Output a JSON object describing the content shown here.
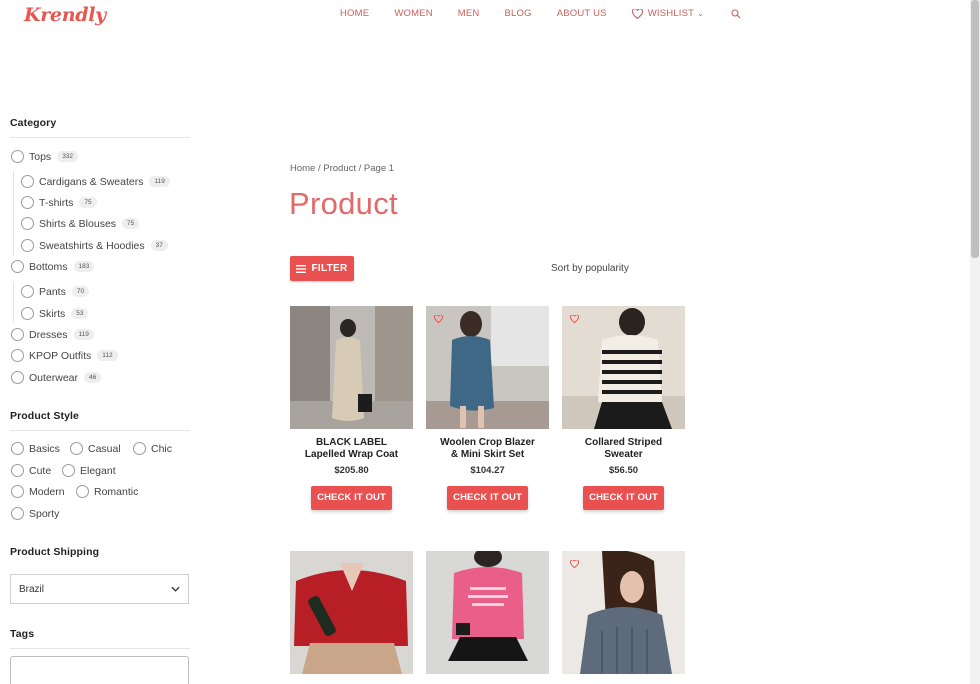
{
  "brand": {
    "logo": "Krendly",
    "accent": "#e8514f"
  },
  "nav": {
    "items": [
      "HOME",
      "WOMEN",
      "MEN",
      "BLOG",
      "ABOUT US"
    ],
    "wishlist": "WISHLIST",
    "wishlist_caret": "⌄"
  },
  "sidebar": {
    "category_heading": "Category",
    "categories": [
      {
        "label": "Tops",
        "count": "332"
      },
      {
        "label": "Cardigans & Sweaters",
        "count": "119"
      },
      {
        "label": "T-shirts",
        "count": "75"
      },
      {
        "label": "Shirts & Blouses",
        "count": "75"
      },
      {
        "label": "Sweatshirts & Hoodies",
        "count": "37"
      },
      {
        "label": "Bottoms",
        "count": "183"
      },
      {
        "label": "Pants",
        "count": "70"
      },
      {
        "label": "Skirts",
        "count": "53"
      },
      {
        "label": "Dresses",
        "count": "119"
      },
      {
        "label": "KPOP Outfits",
        "count": "112"
      },
      {
        "label": "Outerwear",
        "count": "46"
      }
    ],
    "style_heading": "Product Style",
    "styles": [
      "Basics",
      "Casual",
      "Chic",
      "Cute",
      "Elegant",
      "Modern",
      "Romantic",
      "Sporty"
    ],
    "shipping_heading": "Product Shipping",
    "shipping_value": "Brazil",
    "tags_heading": "Tags"
  },
  "main": {
    "breadcrumb": "Home / Product / Page 1",
    "title": "Product",
    "filter_label": "FILTER",
    "sort_label": "Sort by popularity",
    "products": [
      {
        "title_line1": "BLACK LABEL",
        "title_line2": "Lapelled Wrap Coat",
        "price": "$205.80",
        "cta": "CHECK IT OUT"
      },
      {
        "title_line1": "Woolen Crop Blazer",
        "title_line2": "& Mini Skirt Set",
        "price": "$104.27",
        "cta": "CHECK IT OUT"
      },
      {
        "title_line1": "Collared Striped",
        "title_line2": "Sweater",
        "price": "$56.50",
        "cta": "CHECK IT OUT"
      }
    ]
  }
}
